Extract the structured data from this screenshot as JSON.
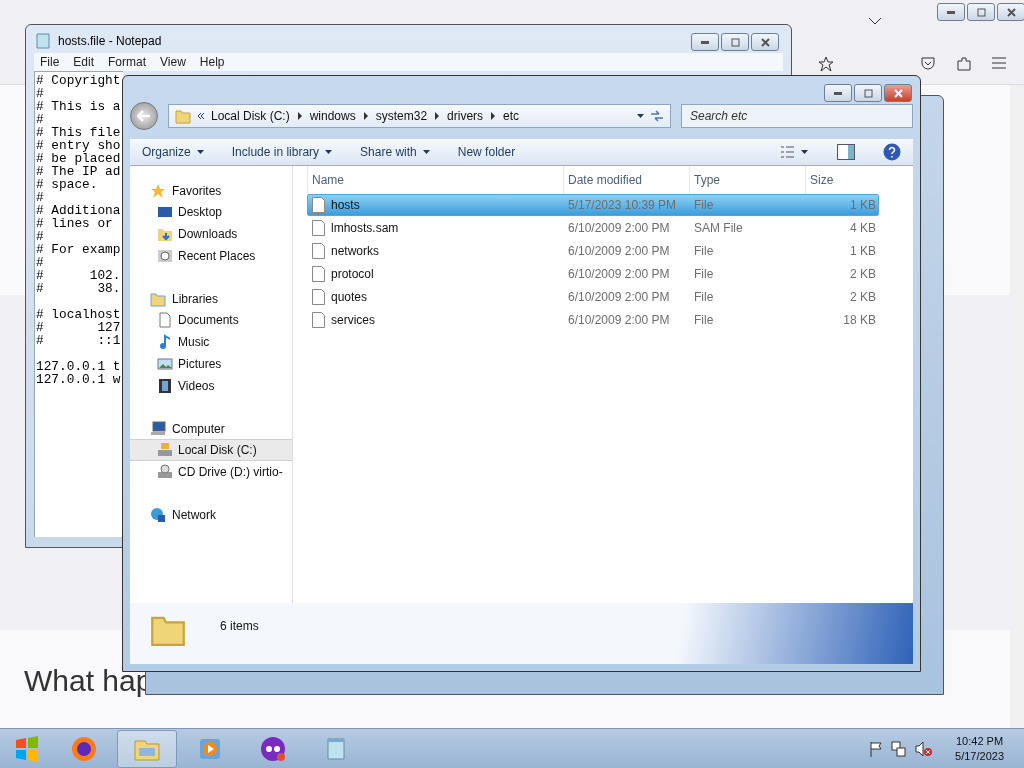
{
  "browser": {
    "heading": "What hap"
  },
  "notepad": {
    "title": "hosts.file - Notepad",
    "menu": [
      "File",
      "Edit",
      "Format",
      "View",
      "Help"
    ],
    "paragraphs": [
      [
        "# Copyright",
        "#",
        "# This is a",
        "#",
        "# This file",
        "# entry sho",
        "# be placed",
        "# The IP ad",
        "# space.",
        "#",
        "# Additiona",
        "# lines or",
        "#",
        "# For examp",
        "#",
        "#      102.",
        "#       38."
      ],
      [
        "# localhost",
        "#       127",
        "#       ::1"
      ],
      [
        "127.0.0.1 t",
        "127.0.0.1 w"
      ]
    ]
  },
  "explorer": {
    "breadcrumbs": [
      "Local Disk (C:)",
      "windows",
      "system32",
      "drivers",
      "etc"
    ],
    "search": {
      "placeholder": "Search etc"
    },
    "toolbar": [
      {
        "label": "Organize",
        "dropdown": true
      },
      {
        "label": "Include in library",
        "dropdown": true
      },
      {
        "label": "Share with",
        "dropdown": true
      },
      {
        "label": "New folder",
        "dropdown": false
      }
    ],
    "nav": [
      {
        "label": "Favorites",
        "kind": "star",
        "children": [
          {
            "label": "Desktop",
            "kind": "desktop",
            "selected": false
          },
          {
            "label": "Downloads",
            "kind": "download",
            "selected": false
          },
          {
            "label": "Recent Places",
            "kind": "recent",
            "selected": false
          }
        ]
      },
      {
        "label": "Libraries",
        "kind": "library",
        "children": [
          {
            "label": "Documents",
            "kind": "document",
            "selected": false
          },
          {
            "label": "Music",
            "kind": "music",
            "selected": false
          },
          {
            "label": "Pictures",
            "kind": "picture",
            "selected": false
          },
          {
            "label": "Videos",
            "kind": "video",
            "selected": false
          }
        ]
      },
      {
        "label": "Computer",
        "kind": "computer",
        "children": [
          {
            "label": "Local Disk (C:)",
            "kind": "disk",
            "selected": true
          },
          {
            "label": "CD Drive (D:) virtio-",
            "kind": "cd",
            "selected": false
          }
        ]
      },
      {
        "label": "Network",
        "kind": "network"
      }
    ],
    "columns": [
      "Name",
      "Date modified",
      "Type",
      "Size"
    ],
    "files": [
      {
        "name": "hosts",
        "date": "5/17/2023 10:39 PM",
        "type": "File",
        "size": "1 KB",
        "selected": true
      },
      {
        "name": "lmhosts.sam",
        "date": "6/10/2009 2:00 PM",
        "type": "SAM File",
        "size": "4 KB",
        "selected": false
      },
      {
        "name": "networks",
        "date": "6/10/2009 2:00 PM",
        "type": "File",
        "size": "1 KB",
        "selected": false
      },
      {
        "name": "protocol",
        "date": "6/10/2009 2:00 PM",
        "type": "File",
        "size": "2 KB",
        "selected": false
      },
      {
        "name": "quotes",
        "date": "6/10/2009 2:00 PM",
        "type": "File",
        "size": "2 KB",
        "selected": false
      },
      {
        "name": "services",
        "date": "6/10/2009 2:00 PM",
        "type": "File",
        "size": "18 KB",
        "selected": false
      }
    ],
    "status": "6 items"
  },
  "taskbar": {
    "apps": [
      {
        "kind": "firefox",
        "selected": false
      },
      {
        "kind": "explorer",
        "selected": true
      },
      {
        "kind": "media",
        "selected": false
      },
      {
        "kind": "purple",
        "selected": false
      },
      {
        "kind": "notepad",
        "selected": false
      }
    ],
    "time": "10:42 PM",
    "date": "5/17/2023"
  }
}
